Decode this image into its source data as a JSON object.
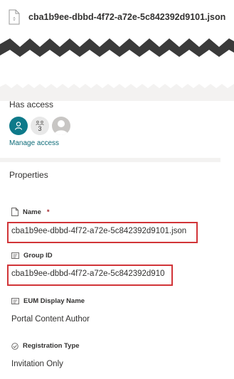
{
  "header": {
    "file_name": "cba1b9ee-dbbd-4f72-a72e-5c842392d9101.json",
    "file_icon": "json-file-icon"
  },
  "access": {
    "title": "Has access",
    "group_count": "3",
    "manage_link": "Manage access"
  },
  "properties": {
    "title": "Properties",
    "fields": [
      {
        "label": "Name",
        "required_mark": "*",
        "value": "cba1b9ee-dbbd-4f72-a72e-5c842392d9101.json",
        "icon": "document-icon"
      },
      {
        "label": "Group ID",
        "value": "cba1b9ee-dbbd-4f72-a72e-5c842392d910",
        "icon": "text-field-icon"
      },
      {
        "label": "EUM Display Name",
        "value": "Portal Content Author",
        "icon": "text-field-icon"
      },
      {
        "label": "Registration Type",
        "value": "Invitation Only",
        "icon": "choice-icon"
      }
    ]
  },
  "colors": {
    "accent": "#0e7a8a",
    "link": "#0b6a77",
    "highlight": "#d13438",
    "required": "#a4262c"
  }
}
